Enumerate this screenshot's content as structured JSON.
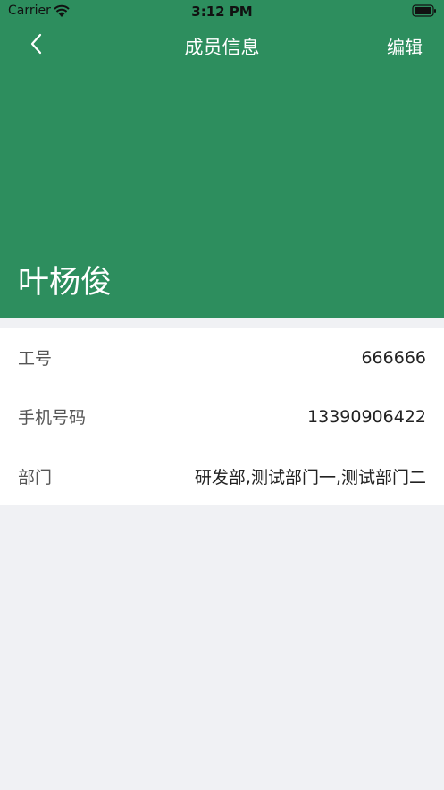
{
  "status_bar": {
    "carrier": "Carrier",
    "time": "3:12 PM",
    "icons": [
      "wifi-icon",
      "battery-icon"
    ]
  },
  "nav": {
    "back_icon": "chevron-left-icon",
    "title": "成员信息",
    "edit_label": "编辑"
  },
  "member": {
    "name": "叶杨俊"
  },
  "info_rows": [
    {
      "label": "工号",
      "value": "666666"
    },
    {
      "label": "手机号码",
      "value": "13390906422"
    },
    {
      "label": "部门",
      "value": "研发部,测试部门一,测试部门二"
    }
  ],
  "colors": {
    "header_bg": "#2D8E5E",
    "page_bg": "#F0F1F4",
    "card_bg": "#FFFFFF"
  }
}
